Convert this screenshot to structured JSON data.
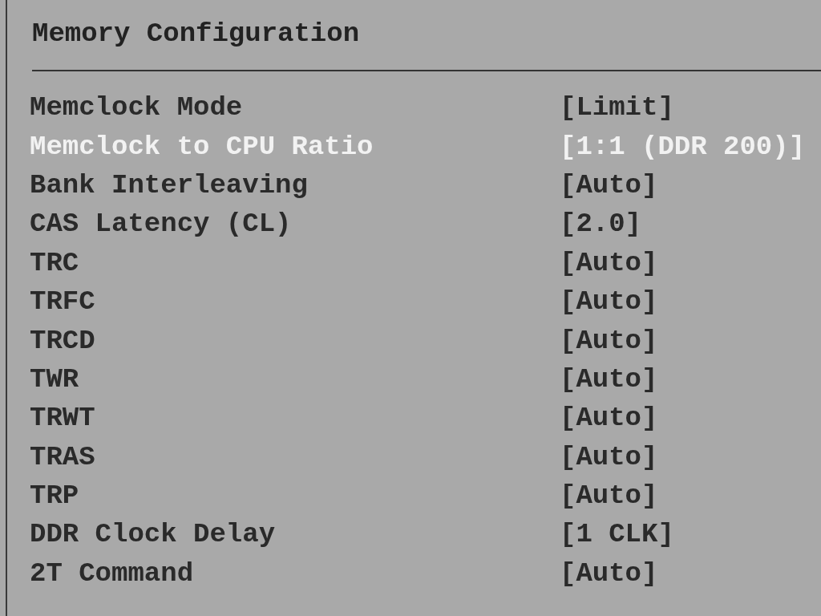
{
  "title": "Memory Configuration",
  "items": [
    {
      "label": "Memclock Mode",
      "value": "[Limit]",
      "selected": false
    },
    {
      "label": "Memclock to CPU Ratio",
      "value": "[1:1 (DDR 200)]",
      "selected": true
    },
    {
      "label": "Bank Interleaving",
      "value": "[Auto]",
      "selected": false
    },
    {
      "label": "CAS Latency (CL)",
      "value": "[2.0]",
      "selected": false
    },
    {
      "label": "TRC",
      "value": "[Auto]",
      "selected": false
    },
    {
      "label": "TRFC",
      "value": "[Auto]",
      "selected": false
    },
    {
      "label": "TRCD",
      "value": "[Auto]",
      "selected": false
    },
    {
      "label": "TWR",
      "value": "[Auto]",
      "selected": false
    },
    {
      "label": "TRWT",
      "value": "[Auto]",
      "selected": false
    },
    {
      "label": "TRAS",
      "value": "[Auto]",
      "selected": false
    },
    {
      "label": "TRP",
      "value": "[Auto]",
      "selected": false
    },
    {
      "label": "DDR Clock Delay",
      "value": "[1 CLK]",
      "selected": false
    },
    {
      "label": "2T Command",
      "value": "[Auto]",
      "selected": false
    }
  ]
}
